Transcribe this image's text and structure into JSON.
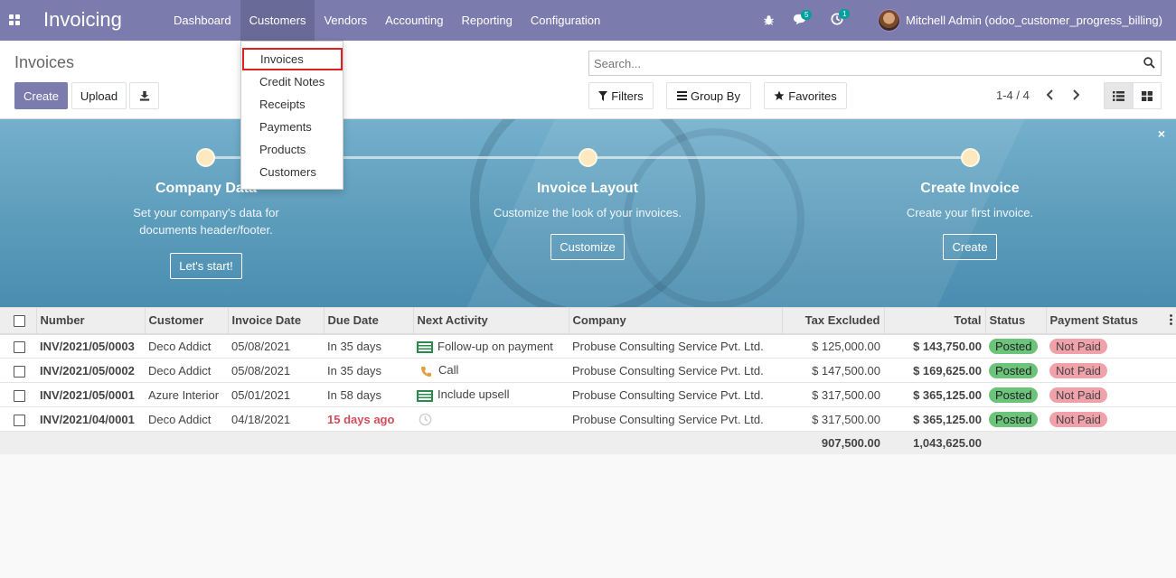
{
  "app": {
    "title": "Invoicing",
    "menu": [
      "Dashboard",
      "Customers",
      "Vendors",
      "Accounting",
      "Reporting",
      "Configuration"
    ],
    "active_menu": "Customers",
    "messages_count": "5",
    "activities_count": "1",
    "user": "Mitchell Admin (odoo_customer_progress_billing)"
  },
  "dropdown": {
    "items": [
      "Invoices",
      "Credit Notes",
      "Receipts",
      "Payments",
      "Products",
      "Customers"
    ],
    "highlighted": "Invoices"
  },
  "control_panel": {
    "breadcrumb": "Invoices",
    "create_label": "Create",
    "upload_label": "Upload",
    "search_placeholder": "Search...",
    "filters_label": "Filters",
    "groupby_label": "Group By",
    "favorites_label": "Favorites",
    "pager": "1-4 / 4"
  },
  "banner": {
    "steps": [
      {
        "title": "Company Data",
        "desc_line1": "Set your company's data for",
        "desc_line2": "documents header/footer.",
        "button": "Let's start!"
      },
      {
        "title": "Invoice Layout",
        "desc_line1": "Customize the look of your invoices.",
        "desc_line2": "",
        "button": "Customize"
      },
      {
        "title": "Create Invoice",
        "desc_line1": "Create your first invoice.",
        "desc_line2": "",
        "button": "Create"
      }
    ],
    "close": "×"
  },
  "table": {
    "columns": [
      "Number",
      "Customer",
      "Invoice Date",
      "Due Date",
      "Next Activity",
      "Company",
      "Tax Excluded",
      "Total",
      "Status",
      "Payment Status"
    ],
    "rows": [
      {
        "number": "INV/2021/05/0003",
        "customer": "Deco Addict",
        "invoice_date": "05/08/2021",
        "due_date": "In 35 days",
        "overdue": false,
        "activity_icon": "invoice-activity-icon",
        "activity": "Follow-up on payment",
        "company": "Probuse Consulting Service Pvt. Ltd.",
        "tax_excluded": "$ 125,000.00",
        "total": "$ 143,750.00",
        "status": "Posted",
        "payment_status": "Not Paid"
      },
      {
        "number": "INV/2021/05/0002",
        "customer": "Deco Addict",
        "invoice_date": "05/08/2021",
        "due_date": "In 35 days",
        "overdue": false,
        "activity_icon": "phone-icon",
        "activity": "Call",
        "company": "Probuse Consulting Service Pvt. Ltd.",
        "tax_excluded": "$ 147,500.00",
        "total": "$ 169,625.00",
        "status": "Posted",
        "payment_status": "Not Paid"
      },
      {
        "number": "INV/2021/05/0001",
        "customer": "Azure Interior",
        "invoice_date": "05/01/2021",
        "due_date": "In 58 days",
        "overdue": false,
        "activity_icon": "invoice-activity-icon",
        "activity": "Include upsell",
        "company": "Probuse Consulting Service Pvt. Ltd.",
        "tax_excluded": "$ 317,500.00",
        "total": "$ 365,125.00",
        "status": "Posted",
        "payment_status": "Not Paid"
      },
      {
        "number": "INV/2021/04/0001",
        "customer": "Deco Addict",
        "invoice_date": "04/18/2021",
        "due_date": "15 days ago",
        "overdue": true,
        "activity_icon": "clock-icon",
        "activity": "",
        "company": "Probuse Consulting Service Pvt. Ltd.",
        "tax_excluded": "$ 317,500.00",
        "total": "$ 365,125.00",
        "status": "Posted",
        "payment_status": "Not Paid"
      }
    ],
    "totals": {
      "tax_excluded": "907,500.00",
      "total": "1,043,625.00"
    }
  },
  "colors": {
    "navbar": "#7c7bad",
    "posted": "#6cc37a",
    "not_paid": "#f1a1a9",
    "overdue": "#d44c59"
  }
}
